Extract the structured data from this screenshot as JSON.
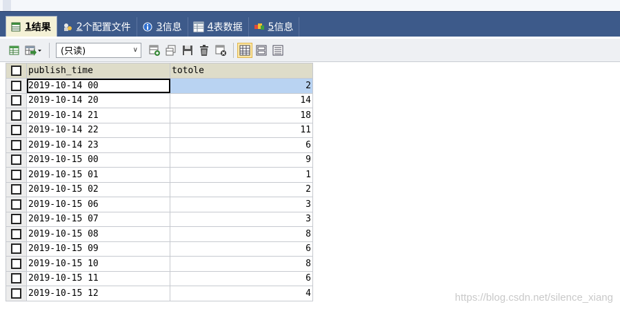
{
  "tabs": [
    {
      "num": "1",
      "label": " 结果",
      "active": true,
      "icon": "result-grid-icon"
    },
    {
      "num": "2",
      "label": " 个配置文件",
      "active": false,
      "icon": "profile-icon"
    },
    {
      "num": "3",
      "label": " 信息",
      "active": false,
      "icon": "info-icon"
    },
    {
      "num": "4",
      "label": " 表数据",
      "active": false,
      "icon": "table-data-icon"
    },
    {
      "num": "5",
      "label": " 信息",
      "active": false,
      "icon": "info2-icon"
    }
  ],
  "toolbar": {
    "mode_value": "(只读)"
  },
  "grid": {
    "columns": [
      "publish_time",
      "totole"
    ],
    "rows": [
      [
        "2019-10-14 00",
        "2"
      ],
      [
        "2019-10-14 20",
        "14"
      ],
      [
        "2019-10-14 21",
        "18"
      ],
      [
        "2019-10-14 22",
        "11"
      ],
      [
        "2019-10-14 23",
        "6"
      ],
      [
        "2019-10-15 00",
        "9"
      ],
      [
        "2019-10-15 01",
        "1"
      ],
      [
        "2019-10-15 02",
        "2"
      ],
      [
        "2019-10-15 06",
        "3"
      ],
      [
        "2019-10-15 07",
        "3"
      ],
      [
        "2019-10-15 08",
        "8"
      ],
      [
        "2019-10-15 09",
        "6"
      ],
      [
        "2019-10-15 10",
        "8"
      ],
      [
        "2019-10-15 11",
        "6"
      ],
      [
        "2019-10-15 12",
        "4"
      ]
    ]
  },
  "watermark": "https://blog.csdn.net/silence_xiang",
  "colors": {
    "tabbar_bg": "#3d5a8a",
    "active_tab_bg": "#f4f1d6",
    "header_bg": "#dedcc9",
    "selected_cell_bg": "#b9d3f2"
  }
}
